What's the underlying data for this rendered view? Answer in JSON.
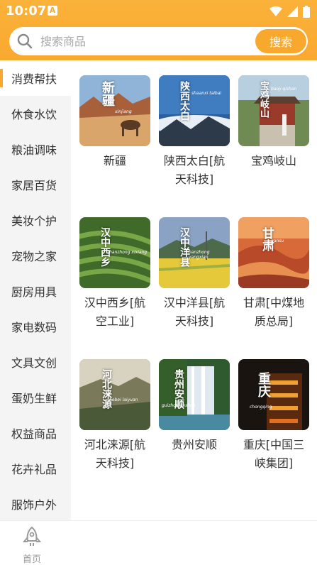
{
  "status": {
    "time": "10:07",
    "notification_badge": "A"
  },
  "search": {
    "placeholder": "搜索商品",
    "button_label": "搜索"
  },
  "sidebar": {
    "items": [
      {
        "label": "消费帮扶",
        "active": true
      },
      {
        "label": "休食水饮"
      },
      {
        "label": "粮油调味"
      },
      {
        "label": "家居百货"
      },
      {
        "label": "美妆个护"
      },
      {
        "label": "宠物之家"
      },
      {
        "label": "厨房用具"
      },
      {
        "label": "家电数码"
      },
      {
        "label": "文具文创"
      },
      {
        "label": "蛋奶生鲜"
      },
      {
        "label": "权益商品"
      },
      {
        "label": "花卉礼品"
      },
      {
        "label": "服饰户外"
      }
    ]
  },
  "products": [
    {
      "label": "新疆",
      "img_title": "新疆",
      "img_sub": "xinjiang"
    },
    {
      "label": "陕西太白[航天科技]",
      "img_title": "陕西太白",
      "img_sub": "shaanxi taibai"
    },
    {
      "label": "宝鸡岐山",
      "img_title": "宝鸡岐山",
      "img_sub": "baoji qishan"
    },
    {
      "label": "汉中西乡[航空工业]",
      "img_title": "汉中西乡",
      "img_sub": "hanzhong xixiang"
    },
    {
      "label": "汉中洋县[航天科技]",
      "img_title": "汉中洋县",
      "img_sub": "hanzhong yangxian"
    },
    {
      "label": "甘肃[中煤地质总局]",
      "img_title": "甘肃",
      "img_sub": "gansu"
    },
    {
      "label": "河北涞源[航天科技]",
      "img_title": "河北涞源",
      "img_sub": "hebei laiyuan"
    },
    {
      "label": "贵州安顺",
      "img_title": "贵州安顺",
      "img_sub": "guizhou anshun"
    },
    {
      "label": "重庆[中国三峡集团]",
      "img_title": "重庆",
      "img_sub": "chongqing"
    }
  ],
  "tabbar": {
    "home_label": "首页"
  },
  "colors": {
    "accent": "#f9a82e",
    "text": "#333333"
  }
}
